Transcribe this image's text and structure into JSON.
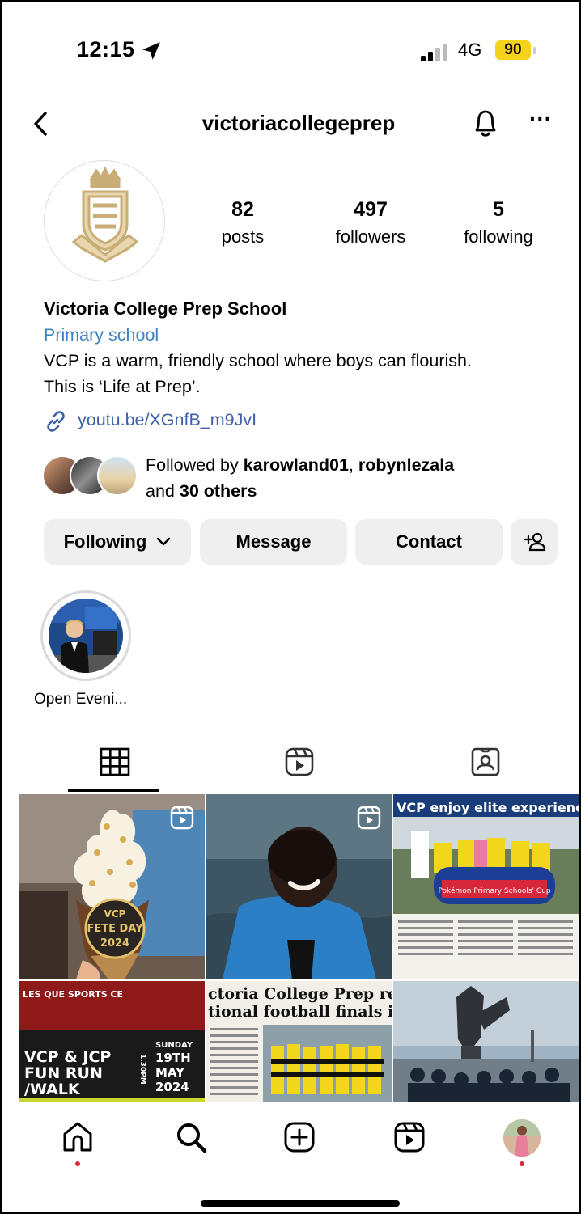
{
  "status_bar": {
    "time": "12:15",
    "network": "4G",
    "battery": "90",
    "battery_color": "#f5d21b"
  },
  "header": {
    "username": "victoriacollegeprep",
    "icons": [
      "back-icon",
      "bell-icon",
      "more-icon"
    ]
  },
  "profile": {
    "stats": [
      {
        "value": "82",
        "label": "posts"
      },
      {
        "value": "497",
        "label": "followers"
      },
      {
        "value": "5",
        "label": "following"
      }
    ],
    "name": "Victoria College Prep School",
    "category": "Primary school",
    "bio_line1": "VCP is a warm, friendly school where boys can flourish.",
    "bio_line2": "This is ‘Life at Prep’.",
    "link": "youtu.be/XGnfB_m9JvI",
    "link_color": "#3b5fa8",
    "category_color": "#3b82c4"
  },
  "followed_by": {
    "prefix": "Followed by ",
    "user1": "karowland01",
    "separator": ", ",
    "user2": "robynlezala",
    "and": "and ",
    "others": "30 others"
  },
  "actions": {
    "following": "Following",
    "message": "Message",
    "contact": "Contact"
  },
  "highlights": [
    {
      "label": "Open Eveni..."
    }
  ],
  "tabs": [
    "grid-icon",
    "reels-icon",
    "tagged-icon"
  ],
  "posts": [
    {
      "overlay_line1": "VCP",
      "overlay_line2": "FETE DAY",
      "overlay_line3": "2024",
      "is_reel": true
    },
    {
      "is_reel": true
    },
    {
      "headline": "VCP enjoy elite experience",
      "banner": "Pokémon Primary Schools' Cup"
    },
    {
      "top_text": "LES QUE SPORTS CE",
      "line1": "VCP & JCP",
      "line2": "FUN RUN",
      "line3": "/WALK",
      "date1": "SUNDAY",
      "date2": "19TH",
      "date3": "MAY",
      "date4": "2024",
      "side": "1.30PM"
    },
    {
      "headline1": "ctoria College Prep reac",
      "headline2": "tional football finals in"
    },
    {}
  ],
  "bottom_nav": [
    "home-icon",
    "search-icon",
    "create-icon",
    "reels-icon",
    "profile-avatar"
  ]
}
